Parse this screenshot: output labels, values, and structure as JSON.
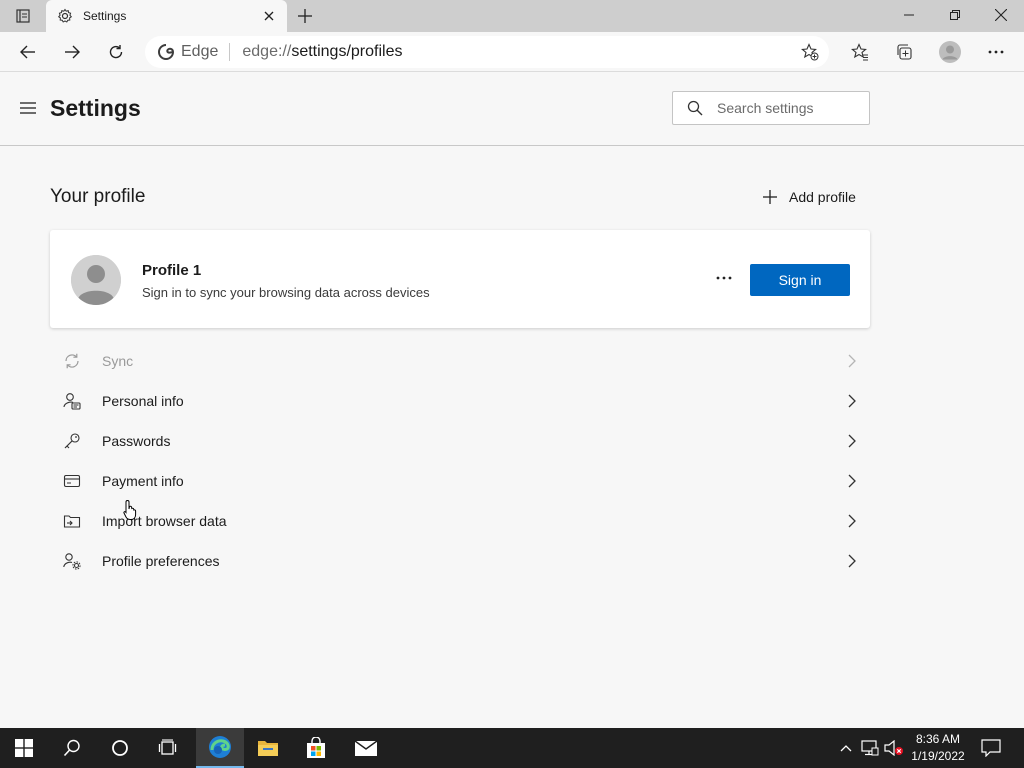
{
  "browser": {
    "tab": {
      "title": "Settings",
      "icon": "gear-icon"
    },
    "address": {
      "site_label": "Edge",
      "url_scheme": "edge://",
      "url_path": "settings/profiles"
    }
  },
  "settings": {
    "title": "Settings",
    "search": {
      "placeholder": "Search settings"
    }
  },
  "profile_section": {
    "title": "Your profile",
    "add_profile_label": "Add profile",
    "card": {
      "name": "Profile 1",
      "subtitle": "Sign in to sync your browsing data across devices",
      "more_label": "···",
      "sign_in_label": "Sign in"
    },
    "menu_items": [
      {
        "label": "Sync",
        "icon": "sync-icon",
        "disabled": true
      },
      {
        "label": "Personal info",
        "icon": "personal-info-icon",
        "disabled": false
      },
      {
        "label": "Passwords",
        "icon": "key-icon",
        "disabled": false
      },
      {
        "label": "Payment info",
        "icon": "credit-card-icon",
        "disabled": false
      },
      {
        "label": "Import browser data",
        "icon": "import-icon",
        "disabled": false
      },
      {
        "label": "Profile preferences",
        "icon": "profile-preferences-icon",
        "disabled": false
      }
    ]
  },
  "taskbar": {
    "time": "8:36 AM",
    "date": "1/19/2022"
  },
  "colors": {
    "accent": "#0067c0",
    "tabstrip": "#cecece",
    "taskbar": "#1f1f1f"
  }
}
